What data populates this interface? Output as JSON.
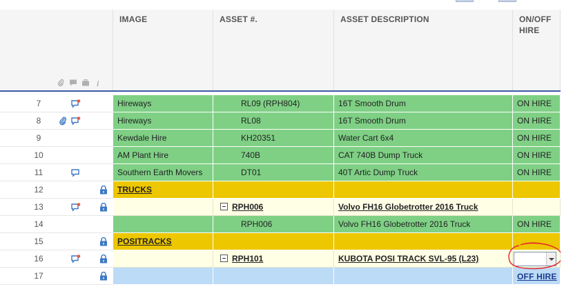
{
  "columns": {
    "image": "IMAGE",
    "asset": "ASSET #.",
    "description": "ASSET DESCRIPTION",
    "hire_line1": "ON/OFF",
    "hire_line2": "HIRE"
  },
  "header_icons": [
    "paperclip-icon",
    "comment-icon",
    "briefcase-icon",
    "info-icon"
  ],
  "colors": {
    "green": "#7fd085",
    "yellow": "#edc700",
    "cream": "#ffffe6",
    "blue": "#bcdbf7",
    "comment_icon": "#3d78c2",
    "comment_dot": "#e85a3a",
    "scribble": "#e5252a"
  },
  "rows": [
    {
      "num": "7",
      "image": "Hireways",
      "asset": "RL09 (RPH804)",
      "description": "16T Smooth Drum",
      "hire": "ON HIRE"
    },
    {
      "num": "8",
      "image": "Hireways",
      "asset": "RL08",
      "description": "16T Smooth Drum",
      "hire": "ON HIRE"
    },
    {
      "num": "9",
      "image": "Kewdale Hire",
      "asset": "KH20351",
      "description": "Water Cart 6x4",
      "hire": "ON HIRE"
    },
    {
      "num": "10",
      "image": "AM Plant Hire",
      "asset": "740B",
      "description": "CAT 740B Dump Truck",
      "hire": "ON HIRE"
    },
    {
      "num": "11",
      "image": "Southern Earth Movers",
      "asset": "DT01",
      "description": "40T Artic Dump Truck",
      "hire": "ON HIRE"
    },
    {
      "num": "12",
      "image": "TRUCKS",
      "asset": "",
      "description": "",
      "hire": ""
    },
    {
      "num": "13",
      "image": "",
      "asset": "RPH006",
      "description": "Volvo FH16 Globetrotter 2016 Truck",
      "hire": ""
    },
    {
      "num": "14",
      "image": "",
      "asset": "RPH006",
      "description": "Volvo FH16 Globetrotter 2016 Truck",
      "hire": "ON HIRE"
    },
    {
      "num": "15",
      "image": "POSITRACKS",
      "asset": "",
      "description": "",
      "hire": ""
    },
    {
      "num": "16",
      "image": "",
      "asset": "RPH101",
      "description": "KUBOTA POSI TRACK SVL-95 (L23)",
      "hire": ""
    },
    {
      "num": "17",
      "image": "",
      "asset": "",
      "description": "",
      "hire": ""
    }
  ],
  "dropdown": {
    "value": "",
    "option": "OFF HIRE"
  }
}
